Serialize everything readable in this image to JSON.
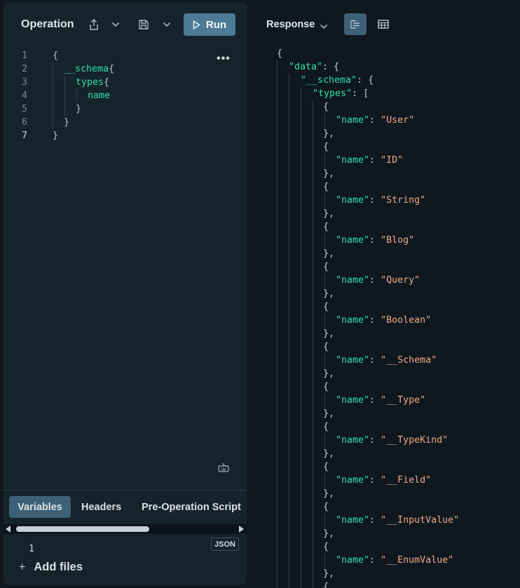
{
  "operation": {
    "title": "Operation",
    "run_label": "Run",
    "line_numbers": [
      "1",
      "2",
      "3",
      "4",
      "5",
      "6",
      "7"
    ],
    "code": {
      "open": "{",
      "schema": "__schema",
      "schema_brace": "{",
      "types": "types",
      "types_brace": "{",
      "name": "name",
      "close5": "}",
      "close6": "}",
      "close7": "}"
    },
    "more_label": "•••"
  },
  "bottom": {
    "tabs": [
      "Variables",
      "Headers",
      "Pre-Operation Script"
    ],
    "active_tab": "Variables",
    "variables_line": "1",
    "format_badge": "JSON",
    "add_files_label": "Add files",
    "add_files_icon": "+"
  },
  "response": {
    "title": "Response",
    "view_modes": [
      "tree-view-icon",
      "table-view-icon"
    ],
    "open": "{",
    "data_key": "\"data\"",
    "schema_key": "\"__schema\"",
    "types_key": "\"types\"",
    "array_open": "[",
    "name_key": "\"name\"",
    "open_brace": "{",
    "close_brace": "},",
    "types": [
      "\"User\"",
      "\"ID\"",
      "\"String\"",
      "\"Blog\"",
      "\"Query\"",
      "\"Boolean\"",
      "\"__Schema\"",
      "\"__Type\"",
      "\"__TypeKind\"",
      "\"__Field\"",
      "\"__InputValue\"",
      "\"__EnumValue\""
    ]
  },
  "colors": {
    "accent": "#4d7a96",
    "active_tab": "#3e6178",
    "field": "#2ee0a6",
    "string": "#f0a98a",
    "panel": "#15232c",
    "background": "#0f181e"
  }
}
